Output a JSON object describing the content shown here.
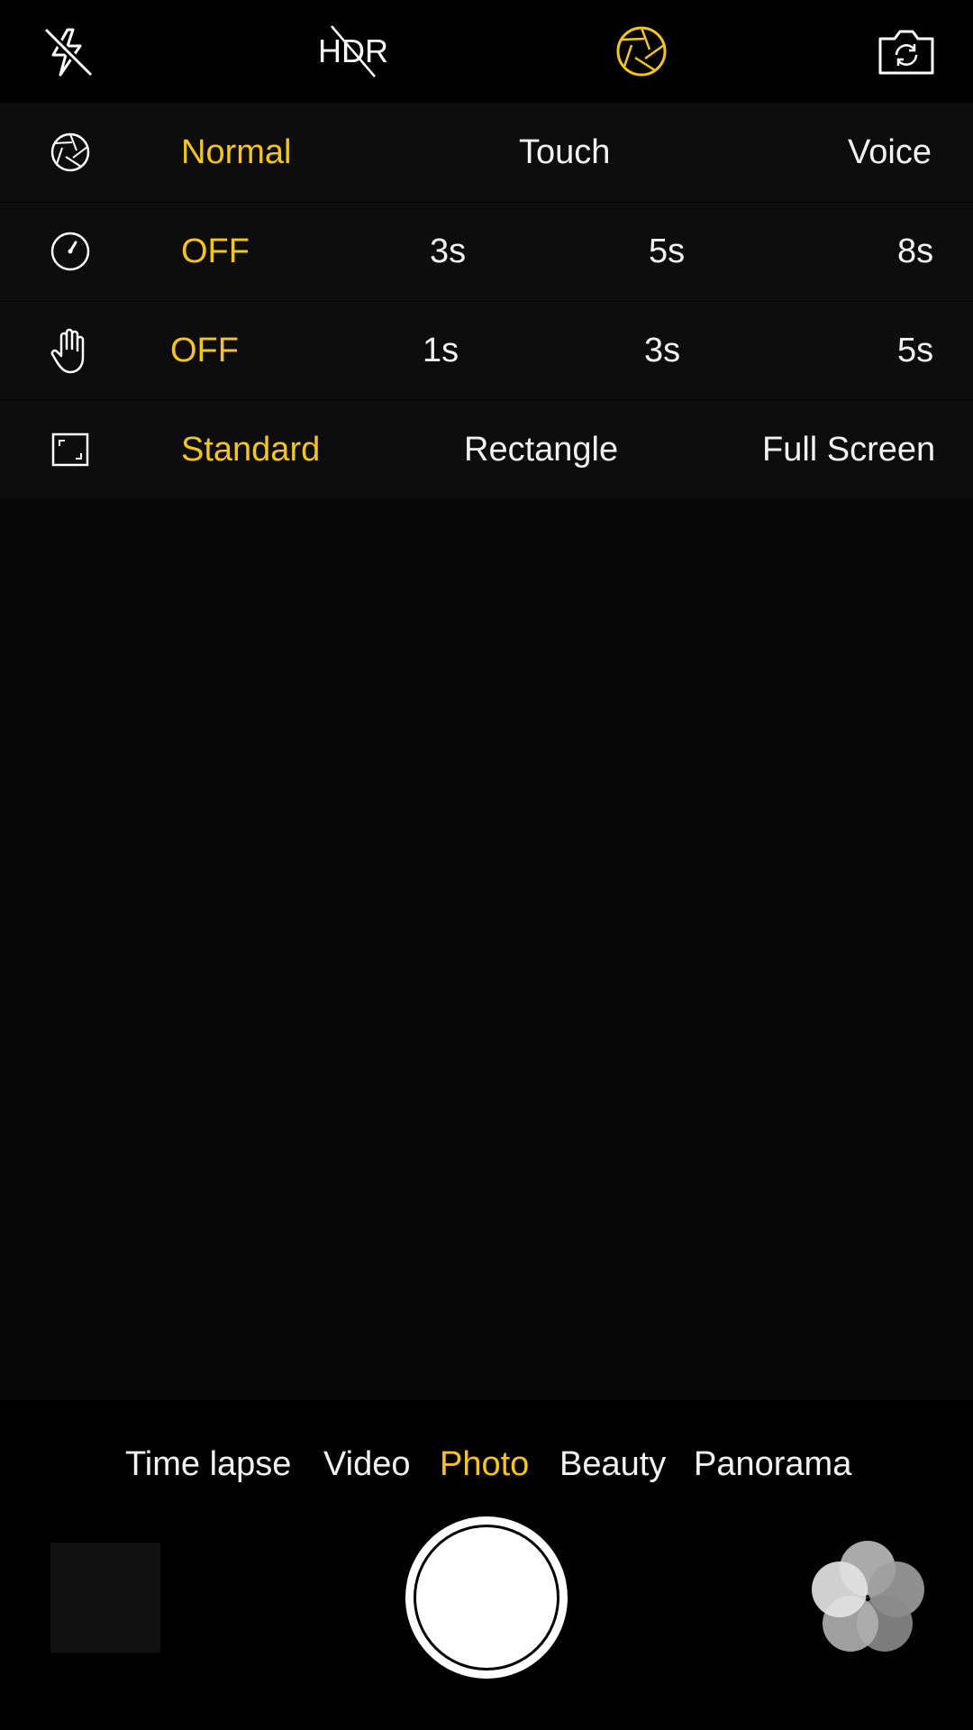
{
  "colors": {
    "accent": "#f5c518",
    "text": "#f2f2f2",
    "background": "#000000",
    "panel": "#0d0d0d"
  },
  "topbar": {
    "flash_icon": "flash-off-icon",
    "hdr_label": "HDR",
    "hdr_state": "off",
    "aperture_icon": "aperture-icon",
    "switch_camera_icon": "switch-camera-icon"
  },
  "settings": {
    "shutter": {
      "icon": "aperture-icon",
      "options": [
        "Normal",
        "Touch",
        "Voice"
      ],
      "selected": "Normal"
    },
    "timer": {
      "icon": "timer-icon",
      "options": [
        "OFF",
        "3s",
        "5s",
        "8s"
      ],
      "selected": "OFF"
    },
    "gesture": {
      "icon": "hand-icon",
      "options": [
        "OFF",
        "1s",
        "3s",
        "5s"
      ],
      "selected": "OFF"
    },
    "ratio": {
      "icon": "frame-ratio-icon",
      "options": [
        "Standard",
        "Rectangle",
        "Full Screen"
      ],
      "selected": "Standard"
    }
  },
  "modes": {
    "items": [
      "Time lapse",
      "Video",
      "Photo",
      "Beauty",
      "Panorama"
    ],
    "selected": "Photo"
  },
  "bottom": {
    "gallery_icon": "gallery-thumbnail",
    "shutter_icon": "shutter-button",
    "filters_icon": "filters-icon"
  }
}
